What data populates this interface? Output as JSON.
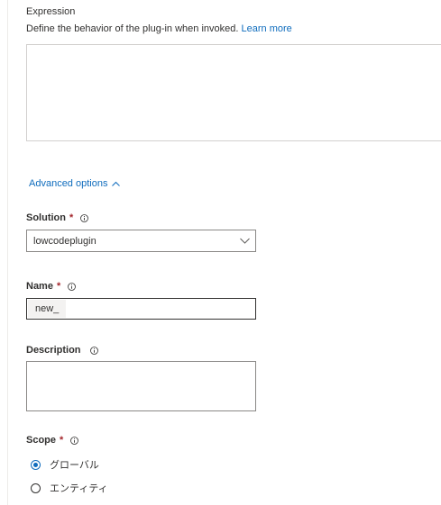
{
  "expression": {
    "label": "Expression",
    "helper_text": "Define the behavior of the plug-in when invoked.",
    "learn_more": "Learn more",
    "value": ""
  },
  "advanced": {
    "label": "Advanced options"
  },
  "solution": {
    "label": "Solution",
    "required_mark": "*",
    "selected": "lowcodeplugin"
  },
  "name": {
    "label": "Name",
    "required_mark": "*",
    "prefix": "new_",
    "value": ""
  },
  "description": {
    "label": "Description",
    "value": ""
  },
  "scope": {
    "label": "Scope",
    "required_mark": "*",
    "options": [
      {
        "label": "グローバル",
        "checked": true
      },
      {
        "label": "エンティティ",
        "checked": false
      }
    ]
  },
  "colors": {
    "accent": "#0f6cbd",
    "required": "#a4262c",
    "text": "#323130",
    "border": "#8a8886"
  }
}
